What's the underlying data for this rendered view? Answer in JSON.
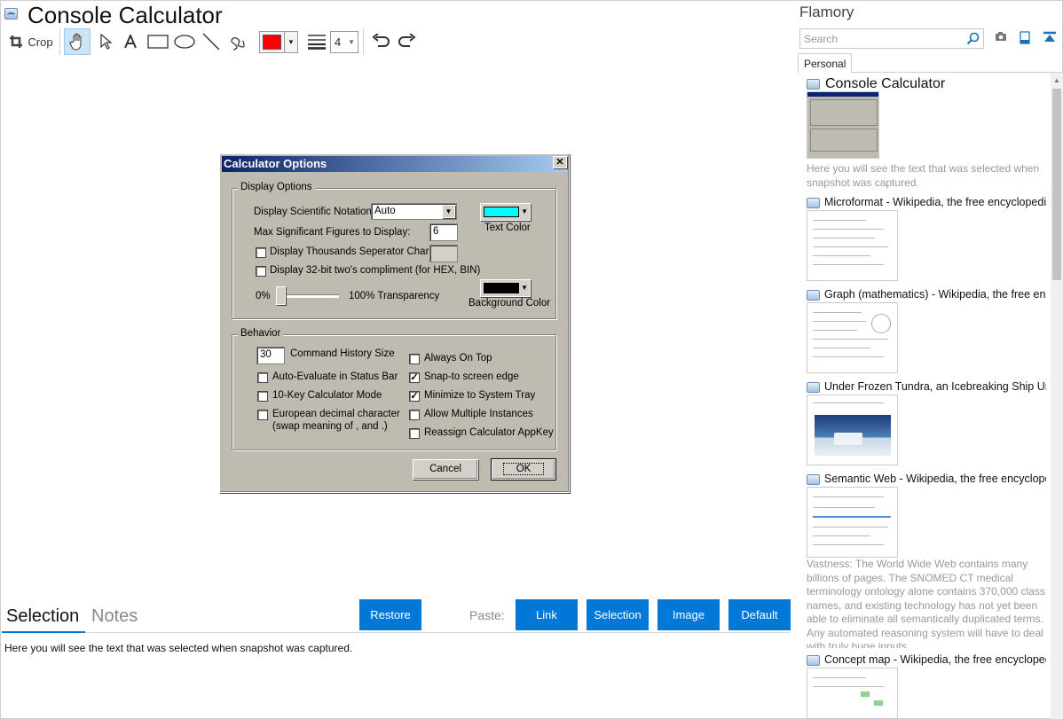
{
  "app": {
    "title": "Console Calculator"
  },
  "toolbar": {
    "crop_label": "Crop",
    "draw_color": "#ff0000",
    "line_width": "4",
    "tools": [
      "hand-icon",
      "select-arrow-icon",
      "text-icon",
      "rectangle-icon",
      "ellipse-icon",
      "line-icon",
      "freehand-icon",
      "line-width-icon",
      "undo-icon",
      "redo-icon"
    ]
  },
  "dialog": {
    "title": "Calculator Options",
    "close_label": "✕",
    "display_group": "Display Options",
    "sci_notation_label": "Display Scientific Notation:",
    "sci_notation_value": "Auto",
    "max_sig_label": "Max Significant Figures to Display:",
    "max_sig_value": "6",
    "text_color_label": "Text Color",
    "text_color": "#00ffff",
    "thousands_label": "Display Thousands Seperator Char:",
    "thousands_checked": false,
    "twos_label": "Display 32-bit two's compliment (for HEX, BIN)",
    "twos_checked": false,
    "transparency_min": "0%",
    "transparency_max": "100% Transparency",
    "transparency_value": 0,
    "bg_color_label": "Background Color",
    "bg_color": "#000000",
    "behavior_group": "Behavior",
    "history_value": "30",
    "history_label": "Command History Size",
    "autoeval_label": "Auto-Evaluate in Status Bar",
    "autoeval_checked": false,
    "tenkey_label": "10-Key Calculator Mode",
    "tenkey_checked": false,
    "european_label": "European decimal character",
    "european_sub": "(swap meaning of , and .)",
    "european_checked": false,
    "ontop_label": "Always On Top",
    "ontop_checked": false,
    "snap_label": "Snap-to screen edge",
    "snap_checked": true,
    "tray_label": "Minimize to System Tray",
    "tray_checked": true,
    "multi_label": "Allow Multiple Instances",
    "multi_checked": false,
    "appkey_label": "Reassign Calculator AppKey",
    "appkey_checked": false,
    "cancel_label": "Cancel",
    "ok_label": "OK"
  },
  "bottom": {
    "tab_selection": "Selection",
    "tab_notes": "Notes",
    "restore_label": "Restore",
    "paste_label": "Paste:",
    "paste_buttons": [
      "Link",
      "Selection",
      "Image",
      "Default"
    ],
    "selection_text": "Here you will see the text that was selected when snapshot was captured."
  },
  "sidebar": {
    "title": "Flamory",
    "search_placeholder": "Search",
    "tab_personal": "Personal",
    "items": [
      {
        "title": "Console Calculator",
        "desc": "Here you will see the text that was selected when snapshot was captured."
      },
      {
        "title": "Microformat - Wikipedia, the free encyclopedia"
      },
      {
        "title": "Graph (mathematics) - Wikipedia, the free encyclopedia"
      },
      {
        "title": "Under Frozen Tundra, an Icebreaking Ship Uncovers"
      },
      {
        "title": "Semantic Web - Wikipedia, the free encyclopedia",
        "desc": "Vastness: The World Wide Web contains many billions of pages. The SNOMED CT medical terminology ontology alone contains 370,000 class names, and existing technology has not yet been able to eliminate all semantically duplicated terms. Any automated reasoning system will have to deal with truly huge inputs."
      },
      {
        "title": "Concept map - Wikipedia, the free encyclopedia"
      }
    ]
  }
}
